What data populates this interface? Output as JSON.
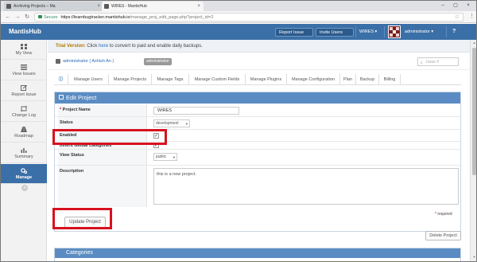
{
  "browser": {
    "tabs": [
      {
        "title": "Archiving Projects – Ma",
        "active": false
      },
      {
        "title": "WIRES - MantisHub",
        "active": true
      }
    ],
    "window_title": "",
    "tab_close": "×",
    "secure_label": "Secure",
    "url_host": "https://learnbugtracker.mantishub.io",
    "url_path": "/manage_proj_edit_page.php?project_id=2",
    "back_icon": "←",
    "forward_icon": "→",
    "reload_icon": "↻",
    "star_icon": "☆",
    "menu_icon": "⋮",
    "window_controls": [
      "–",
      "▢",
      "×"
    ]
  },
  "navbar": {
    "brand": "MantisHub",
    "report_issue": "Report Issue",
    "invite_users": "Invite Users",
    "project_selector": "WIRES ▾",
    "user_name": "administrator ▾",
    "help": "?",
    "colors": {
      "bar": "#3b6fa7"
    }
  },
  "sidebar": {
    "items": [
      {
        "label": "My View",
        "icon": "dashboard-icon",
        "active": false
      },
      {
        "label": "View Issues",
        "icon": "list-icon",
        "active": false
      },
      {
        "label": "Report Issue",
        "icon": "edit-icon",
        "active": false
      },
      {
        "label": "Change Log",
        "icon": "retweet-icon",
        "active": false
      },
      {
        "label": "Roadmap",
        "icon": "road-icon",
        "active": false
      },
      {
        "label": "Summary",
        "icon": "bar-chart-icon",
        "active": false
      },
      {
        "label": "Manage",
        "icon": "gears-icon",
        "active": true
      }
    ],
    "collapse_icon": "«"
  },
  "trial": {
    "label": "Trial Version:",
    "text_before": " Click ",
    "link": "here",
    "text_after": " to convert to paid and enable daily backups."
  },
  "breadcrumb": {
    "user": "administrator ( Ashish An )",
    "role": "administrator",
    "search_placeholder": "Issue #"
  },
  "manage_tabs": [
    {
      "label": "ⓘ"
    },
    {
      "label": "Manage Users"
    },
    {
      "label": "Manage Projects"
    },
    {
      "label": "Manage Tags"
    },
    {
      "label": "Manage Custom Fields"
    },
    {
      "label": "Manage Plugins"
    },
    {
      "label": "Manage Configuration"
    },
    {
      "label": "Plan"
    },
    {
      "label": "Backup"
    },
    {
      "label": "Billing"
    }
  ],
  "edit_project": {
    "title": "Edit Project",
    "fields": {
      "project_name": {
        "label": "Project Name",
        "required": "*",
        "value": "WIRES"
      },
      "status": {
        "label": "Status",
        "value": "development"
      },
      "enabled": {
        "label": "Enabled",
        "checked": true,
        "mark": "✓"
      },
      "inherit": {
        "label": "Inherit Global Categories",
        "checked": true,
        "mark": "✓"
      },
      "view_status": {
        "label": "View Status",
        "value": "public"
      },
      "description": {
        "label": "Description",
        "value": "this is a new project."
      }
    },
    "required_note_star": "*",
    "required_note": " required",
    "update_button": "Update Project"
  },
  "delete_button": "Delete Project",
  "categories": {
    "title": "Categories"
  },
  "annotations": {
    "callout_color": "#d6121f"
  }
}
